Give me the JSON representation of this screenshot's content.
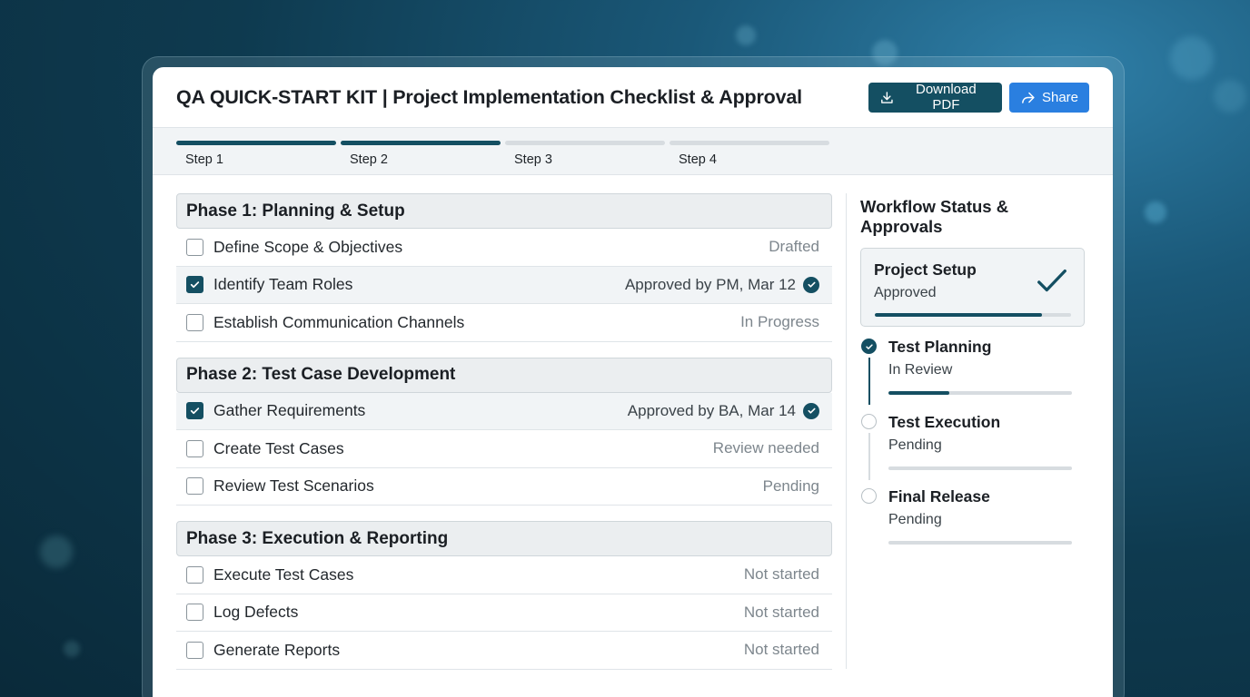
{
  "header": {
    "title": "QA QUICK-START KIT | Project Implementation Checklist & Approval",
    "download_label": "Download PDF",
    "share_label": "Share"
  },
  "steps": [
    {
      "label": "Step 1",
      "done": true
    },
    {
      "label": "Step 2",
      "done": true
    },
    {
      "label": "Step 3",
      "done": false
    },
    {
      "label": "Step 4",
      "done": false
    }
  ],
  "phases": [
    {
      "title": "Phase 1: Planning & Setup",
      "items": [
        {
          "label": "Define Scope & Objectives",
          "status": "Drafted",
          "checked": false
        },
        {
          "label": "Identify Team Roles",
          "status": "Approved by PM, Mar 12",
          "checked": true
        },
        {
          "label": "Establish Communication Channels",
          "status": "In Progress",
          "checked": false
        }
      ]
    },
    {
      "title": "Phase 2: Test Case Development",
      "items": [
        {
          "label": "Gather Requirements",
          "status": "Approved by BA, Mar 14",
          "checked": true
        },
        {
          "label": "Create Test Cases",
          "status": "Review needed",
          "checked": false
        },
        {
          "label": "Review Test Scenarios",
          "status": "Pending",
          "checked": false
        }
      ]
    },
    {
      "title": "Phase 3: Execution & Reporting",
      "items": [
        {
          "label": "Execute Test Cases",
          "status": "Not started",
          "checked": false
        },
        {
          "label": "Log Defects",
          "status": "Not started",
          "checked": false
        },
        {
          "label": "Generate Reports",
          "status": "Not started",
          "checked": false
        }
      ]
    }
  ],
  "workflow": {
    "title": "Workflow Status & Approvals",
    "setup": {
      "title": "Project Setup",
      "status": "Approved",
      "progress": 0.85
    },
    "stages": [
      {
        "title": "Test Planning",
        "status": "In Review",
        "progress": 0.33,
        "done": true
      },
      {
        "title": "Test Execution",
        "status": "Pending",
        "progress": 0,
        "done": false
      },
      {
        "title": "Final Release",
        "status": "Pending",
        "progress": 0,
        "done": false
      }
    ]
  },
  "colors": {
    "primary": "#144f62",
    "share": "#2a7fe0",
    "muted": "#7d868d"
  }
}
